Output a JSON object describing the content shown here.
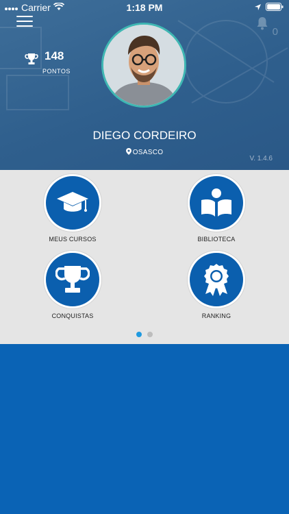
{
  "status_bar": {
    "carrier": "Carrier",
    "time": "1:18 PM"
  },
  "header": {
    "points_value": "148",
    "points_label": "PONTOS",
    "notifications_count": "0",
    "user_name": "DIEGO CORDEIRO",
    "location": "OSASCO",
    "version": "V. 1.4.6"
  },
  "menu": {
    "items": [
      {
        "label": "MEUS CURSOS",
        "icon": "graduation-cap-icon"
      },
      {
        "label": "BIBLIOTECA",
        "icon": "reading-person-icon"
      },
      {
        "label": "CONQUISTAS",
        "icon": "trophy-icon"
      },
      {
        "label": "RANKING",
        "icon": "ribbon-award-icon"
      }
    ]
  },
  "pager": {
    "pages": 2,
    "active": 1
  },
  "colors": {
    "header": "#2f5f8d",
    "accent_blue": "#0b5fae",
    "avatar_ring": "#3fb7b3",
    "grid_bg": "#e5e5e5",
    "active_dot": "#1f9ae0"
  }
}
